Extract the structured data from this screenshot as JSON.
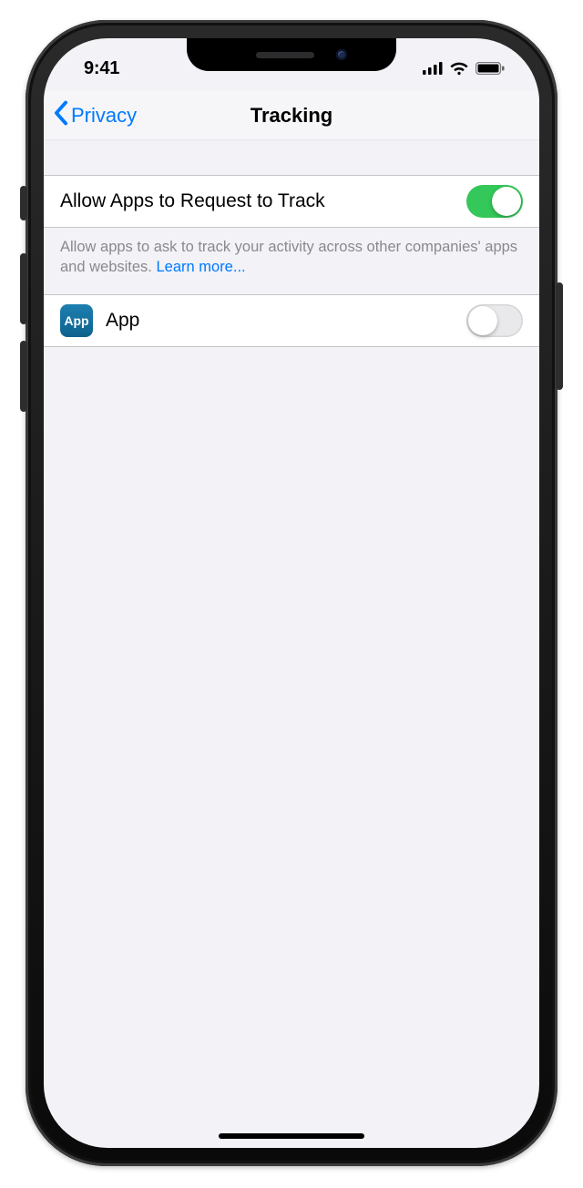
{
  "status": {
    "time": "9:41"
  },
  "nav": {
    "back_label": "Privacy",
    "title": "Tracking"
  },
  "primary": {
    "label": "Allow Apps to Request to Track",
    "enabled": true
  },
  "footer": {
    "text": "Allow apps to ask to track your activity across other companies' apps and websites. ",
    "link": "Learn more..."
  },
  "apps": [
    {
      "icon_label": "App",
      "name": "App",
      "enabled": false
    }
  ]
}
